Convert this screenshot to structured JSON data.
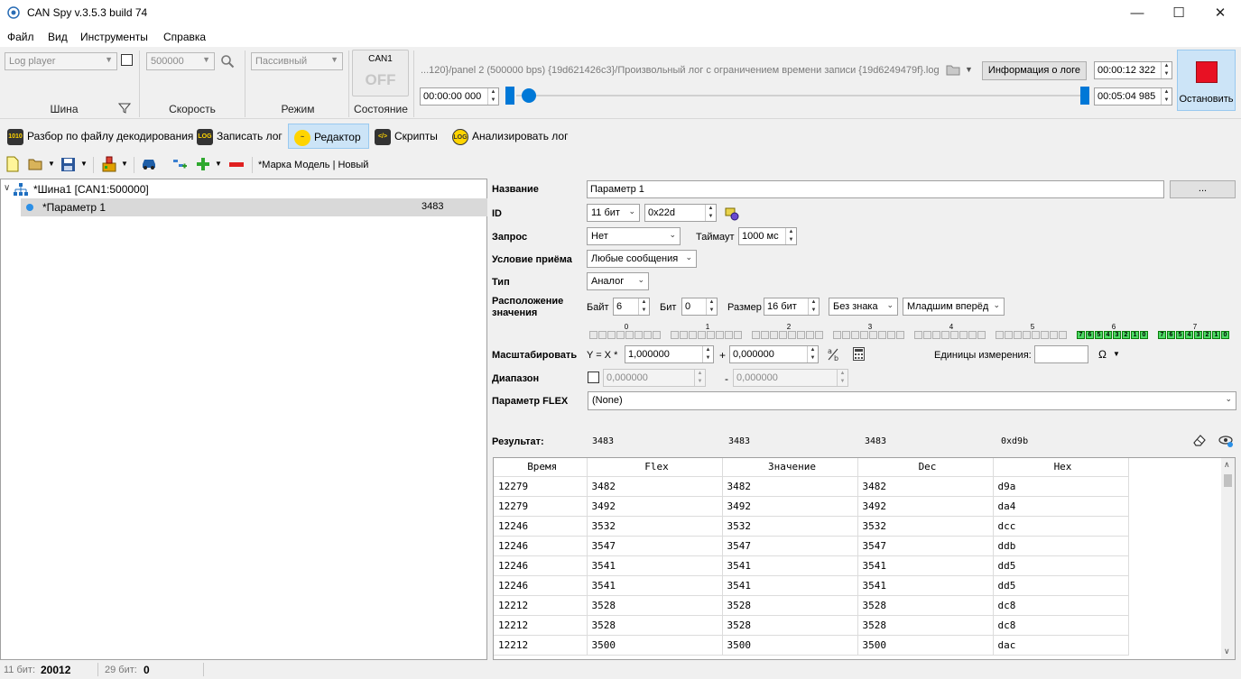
{
  "window": {
    "title": "CAN Spy v.3.5.3 build 74"
  },
  "menu": [
    "Файл",
    "Вид",
    "Инструменты",
    "Справка"
  ],
  "top_toolbar": {
    "bus_combo": "Log player",
    "bus_label": "Шина",
    "speed_combo": "500000",
    "speed_label": "Скорость",
    "mode_combo": "Пассивный",
    "mode_label": "Режим",
    "state_channel": "CAN1",
    "state_value": "OFF",
    "state_label": "Состояние",
    "log_path": "...120}/panel 2 (500000 bps) {19d621426c3}/Произвольный лог с ограничением времени записи {19d6249479f}.log",
    "log_info_button": "Информация о логе",
    "time_start": "00:00:00  000",
    "time_current": "00:00:12 322",
    "time_total": "00:05:04 985",
    "stop_button": "Остановить"
  },
  "tabs": [
    {
      "label": "Разбор по файлу декодирования",
      "icon": "decode-file-icon"
    },
    {
      "label": "Записать лог",
      "icon": "record-log-icon"
    },
    {
      "label": "Редактор",
      "icon": "editor-icon",
      "selected": true
    },
    {
      "label": "Скрипты",
      "icon": "scripts-icon"
    },
    {
      "label": "Анализировать лог",
      "icon": "analyze-log-icon"
    }
  ],
  "editor_toolbar": {
    "model_label": "*Марка Модель | Новый"
  },
  "tree": {
    "bus_node": "*Шина1 [CAN1:500000]",
    "param_node": "*Параметр 1",
    "param_value": "3483"
  },
  "form": {
    "name_label": "Название",
    "name_value": "Параметр 1",
    "name_button": "...",
    "id_label": "ID",
    "id_type": "11 бит",
    "id_value": "0x22d",
    "request_label": "Запрос",
    "request_value": "Нет",
    "timeout_label": "Таймаут",
    "timeout_value": "1000 мс",
    "recv_cond_label": "Условие приёма",
    "recv_cond_value": "Любые сообщения",
    "type_label": "Тип",
    "type_value": "Аналог",
    "location_label": "Расположение значения",
    "byte_label": "Байт",
    "byte_value": "6",
    "bit_label": "Бит",
    "bit_value": "0",
    "size_label": "Размер",
    "size_value": "16 бит",
    "sign_value": "Без знака",
    "order_value": "Младшим вперёд",
    "byte_indices": [
      "0",
      "1",
      "2",
      "3",
      "4",
      "5",
      "6",
      "7"
    ],
    "highlight_bytes": [
      6,
      7
    ],
    "bit_digits": [
      "7",
      "6",
      "5",
      "4",
      "3",
      "2",
      "1",
      "0"
    ],
    "scale_label": "Масштабировать",
    "scale_formula": "Y = X *",
    "scale_value": "1,000000",
    "plus_sign": "+",
    "offset_value": "0,000000",
    "units_label": "Единицы измерения:",
    "units_value": "",
    "units_symbol": "Ω",
    "range_label": "Диапазон",
    "range_min": "0,000000",
    "range_dash": "-",
    "range_max": "0,000000",
    "flex_label": "Параметр FLEX",
    "flex_value": "(None)"
  },
  "result": {
    "label": "Результат:",
    "values": [
      "3483",
      "3483",
      "3483",
      "0xd9b"
    ],
    "columns": [
      "Время",
      "Flex",
      "Значение",
      "Dec",
      "Hex"
    ],
    "rows": [
      [
        "12279",
        "3482",
        "3482",
        "3482",
        "d9a"
      ],
      [
        "12279",
        "3492",
        "3492",
        "3492",
        "da4"
      ],
      [
        "12246",
        "3532",
        "3532",
        "3532",
        "dcc"
      ],
      [
        "12246",
        "3547",
        "3547",
        "3547",
        "ddb"
      ],
      [
        "12246",
        "3541",
        "3541",
        "3541",
        "dd5"
      ],
      [
        "12246",
        "3541",
        "3541",
        "3541",
        "dd5"
      ],
      [
        "12212",
        "3528",
        "3528",
        "3528",
        "dc8"
      ],
      [
        "12212",
        "3528",
        "3528",
        "3528",
        "dc8"
      ],
      [
        "12212",
        "3500",
        "3500",
        "3500",
        "dac"
      ]
    ]
  },
  "status": {
    "label11": "11 бит:",
    "count11": "20012",
    "label29": "29 бит:",
    "count29": "0"
  }
}
